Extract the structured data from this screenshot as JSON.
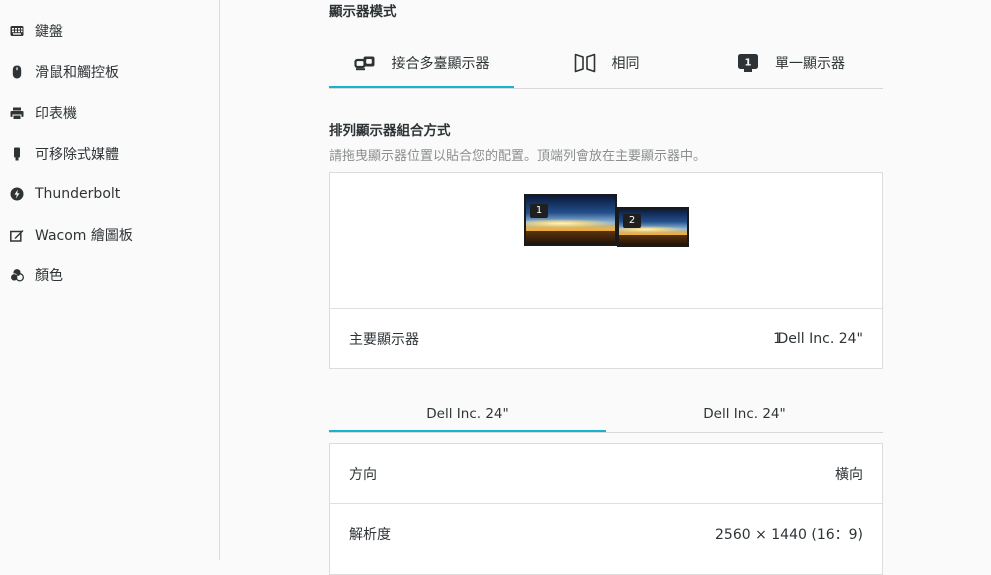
{
  "sidebar": {
    "items": [
      {
        "label": "鍵盤",
        "icon": "keyboard-icon"
      },
      {
        "label": "滑鼠和觸控板",
        "icon": "mouse-icon"
      },
      {
        "label": "印表機",
        "icon": "printer-icon"
      },
      {
        "label": "可移除式媒體",
        "icon": "removable-media-icon"
      },
      {
        "label": "Thunderbolt",
        "icon": "thunderbolt-icon"
      },
      {
        "label": "Wacom 繪圖板",
        "icon": "wacom-tablet-icon"
      },
      {
        "label": "顏色",
        "icon": "color-icon"
      }
    ]
  },
  "display_mode": {
    "title": "顯示器模式",
    "tabs": [
      {
        "label": "接合多臺顯示器",
        "icon": "join-displays-icon",
        "active": true
      },
      {
        "label": "相同",
        "icon": "mirror-icon",
        "active": false
      },
      {
        "label": "單一顯示器",
        "icon": "single-display-icon",
        "active": false
      }
    ],
    "single_icon_number": "1"
  },
  "arrange": {
    "title": "排列顯示器組合方式",
    "subtitle": "請拖曳顯示器位置以貼合您的配置。頂端列會放在主要顯示器中。",
    "monitors": [
      {
        "number": "1"
      },
      {
        "number": "2"
      }
    ],
    "primary_label": "主要顯示器",
    "primary_number": "1",
    "primary_value": "Dell Inc. 24\""
  },
  "display_tabs": [
    {
      "label": "Dell Inc. 24\"",
      "active": true
    },
    {
      "label": "Dell Inc. 24\"",
      "active": false
    }
  ],
  "settings": {
    "orientation_label": "方向",
    "orientation_value": "橫向",
    "resolution_label": "解析度",
    "resolution_value": "2560 × 1440 (16：9)"
  },
  "colors": {
    "accent": "#15b3d0",
    "text": "#2e3436",
    "subtitle": "#8b8e8f",
    "background": "#fafafa"
  }
}
